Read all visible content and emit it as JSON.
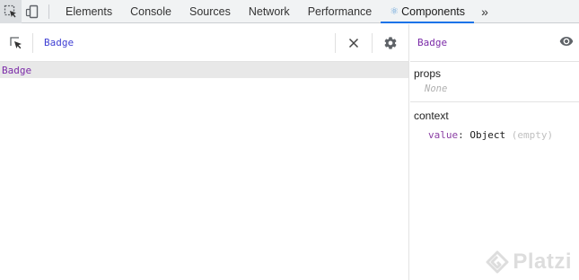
{
  "devtools": {
    "tabs": [
      {
        "label": "Elements",
        "selected": false
      },
      {
        "label": "Console",
        "selected": false
      },
      {
        "label": "Sources",
        "selected": false
      },
      {
        "label": "Network",
        "selected": false
      },
      {
        "label": "Performance",
        "selected": false
      },
      {
        "label": "Components",
        "selected": true,
        "icon": "react-atom-icon"
      }
    ],
    "more_icon": "chevron-double-right-icon",
    "toolbar_icons": [
      "inspect-element-icon",
      "device-toolbar-icon"
    ],
    "accent": "#1a73e8"
  },
  "tree": {
    "search_value": "Badge",
    "select_icon": "select-component-icon",
    "clear_icon": "close-icon",
    "settings_icon": "gear-icon",
    "rows": [
      {
        "label": "Badge",
        "selected": true
      }
    ]
  },
  "inspector": {
    "component_name": "Badge",
    "view_icon": "eye-icon",
    "props": {
      "title": "props",
      "empty_text": "None"
    },
    "context": {
      "title": "context",
      "entries": [
        {
          "key": "value",
          "value": "Object",
          "note": "(empty)"
        }
      ]
    }
  },
  "watermark": {
    "text": "Platzi",
    "icon": "platzi-logo-icon"
  }
}
